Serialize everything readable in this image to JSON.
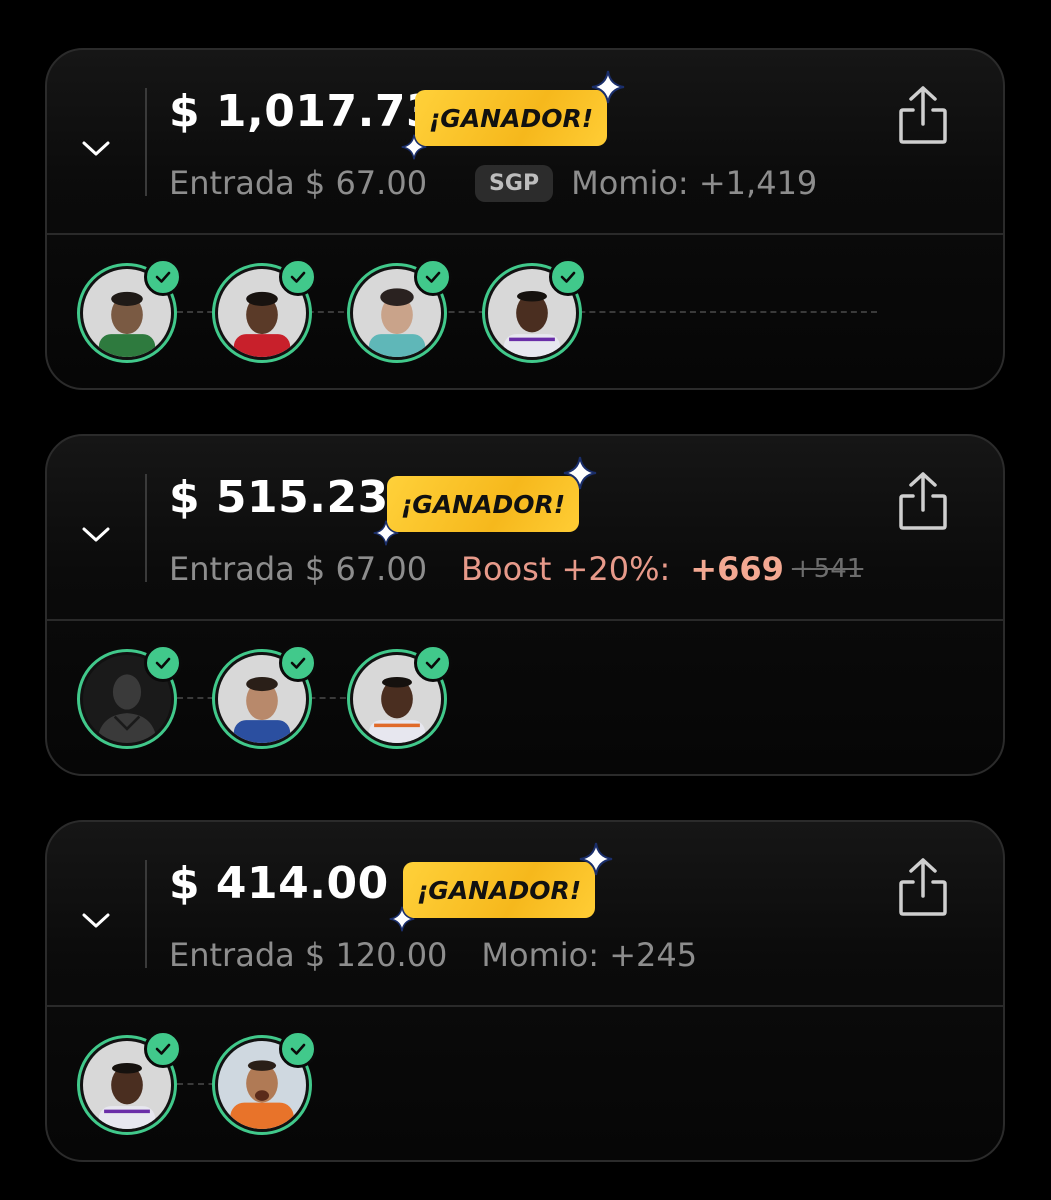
{
  "bets": [
    {
      "payout": "$ 1,017.73",
      "badge": "¡GANADOR!",
      "entry": "Entrada $ 67.00",
      "tag": "SGP",
      "odds": "Momio: +1,419",
      "players": [
        "player-1",
        "player-2",
        "player-3",
        "player-4"
      ]
    },
    {
      "payout": "$ 515.23",
      "badge": "¡GANADOR!",
      "entry": "Entrada $ 67.00",
      "boost_label": "Boost +20%:",
      "boost_odds": "+669",
      "original_odds": "+541",
      "players": [
        "player-placeholder",
        "player-5",
        "player-4"
      ]
    },
    {
      "payout": "$ 414.00",
      "badge": "¡GANADOR!",
      "entry": "Entrada $ 120.00",
      "odds": "Momio: +245",
      "players": [
        "player-4",
        "player-6"
      ]
    }
  ],
  "colors": {
    "badge_bg": "#f6b81c",
    "check_green": "#41c98b",
    "boost_text": "#e79a8a",
    "muted_text": "#8d8d8d"
  },
  "icons": [
    "chevron-down-icon",
    "share-icon",
    "check-icon",
    "sparkle-icon"
  ]
}
